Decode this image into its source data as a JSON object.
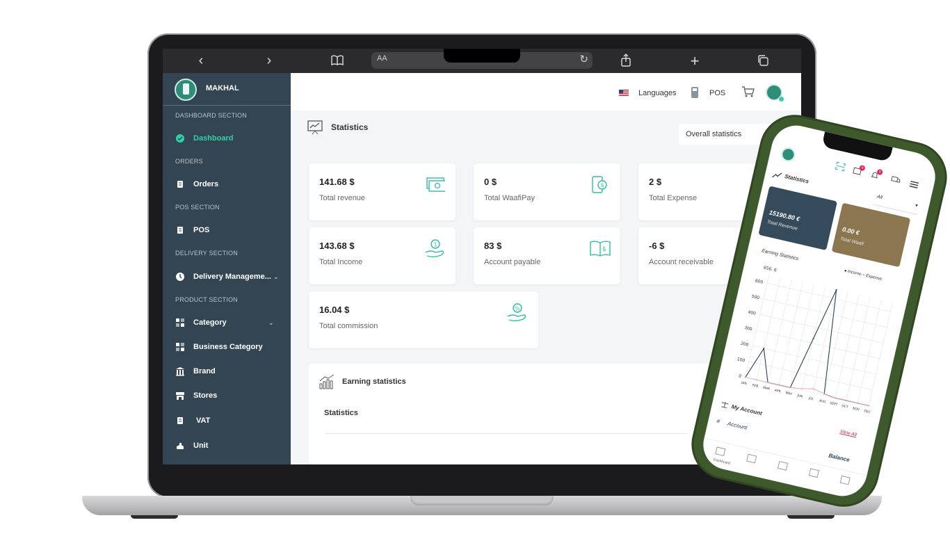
{
  "sidebar": {
    "brand": "MAKHAL",
    "sections": [
      {
        "label": "DASHBOARD SECTION"
      },
      {
        "label": "ORDERS"
      },
      {
        "label": "POS SECTION"
      },
      {
        "label": "DELIVERY SECTION"
      },
      {
        "label": "PRODUCT SECTION"
      }
    ],
    "items": [
      {
        "label": "Dashboard",
        "icon": "dashboard-icon",
        "active": true
      },
      {
        "label": "Orders",
        "icon": "orders-icon"
      },
      {
        "label": "POS",
        "icon": "pos-icon"
      },
      {
        "label": "Delivery Manageme...",
        "icon": "delivery-icon"
      },
      {
        "label": "Category",
        "icon": "category-icon"
      },
      {
        "label": "Business Category",
        "icon": "business-category-icon"
      },
      {
        "label": "Brand",
        "icon": "brand-icon"
      },
      {
        "label": "Stores",
        "icon": "stores-icon"
      },
      {
        "label": "VAT",
        "icon": "vat-icon"
      },
      {
        "label": "Unit",
        "icon": "unit-icon"
      }
    ]
  },
  "browser": {
    "aa": "AA"
  },
  "header": {
    "languages": "Languages",
    "pos": "POS"
  },
  "main": {
    "title": "Statistics",
    "filter": "Overall statistics",
    "cards": [
      {
        "value": "141.68 $",
        "label": "Total revenue"
      },
      {
        "value": "0 $",
        "label": "Total WaafiPay"
      },
      {
        "value": "2 $",
        "label": "Total Expense"
      },
      {
        "value": "143.68 $",
        "label": "Total Income"
      },
      {
        "value": "83 $",
        "label": "Account payable"
      },
      {
        "value": "-6 $",
        "label": "Account receivable"
      },
      {
        "value": "16.04 $",
        "label": "Total commission"
      }
    ],
    "earning": {
      "title": "Earning statistics",
      "subtitle": "Statistics"
    }
  },
  "phone": {
    "title": "Statistics",
    "filter": "All",
    "cards": [
      {
        "value": "15190.80 €",
        "label": "Total Revenue",
        "color": "#354a5a"
      },
      {
        "value": "0.00 €",
        "label": "Total Waafi",
        "color": "#8b7650"
      }
    ],
    "chart_title": "Earning Statistics",
    "account_title": "My Account",
    "view_all": "View All",
    "table_hash": "#",
    "table_account": "Account",
    "table_balance": "Balance",
    "nav": [
      "Dashboard",
      "",
      "",
      "",
      ""
    ],
    "badges": [
      "0",
      "0"
    ]
  },
  "chart_data": {
    "type": "line",
    "title": "Earning Statistics",
    "categories": [
      "JAN",
      "FEB",
      "MAR",
      "APR",
      "MAY",
      "JUN",
      "JUL",
      "AUG",
      "SEPT",
      "OCT",
      "NOV",
      "DEC"
    ],
    "series": [
      {
        "name": "Income",
        "color": "#2c3e50",
        "values": [
          0,
          200,
          0,
          0,
          0,
          330,
          656.6,
          10,
          0,
          0,
          0,
          0
        ]
      },
      {
        "name": "Expense",
        "color": "#e7a3b4",
        "values": [
          0,
          0,
          0,
          0,
          0,
          10,
          25,
          10,
          0,
          0,
          0,
          0
        ]
      }
    ],
    "yticks": [
      "0",
      "100",
      "200",
      "300",
      "400",
      "500",
      "600",
      "656.\n6"
    ],
    "ylim": [
      0,
      656.6
    ],
    "grid": true,
    "legend": "top-right"
  }
}
